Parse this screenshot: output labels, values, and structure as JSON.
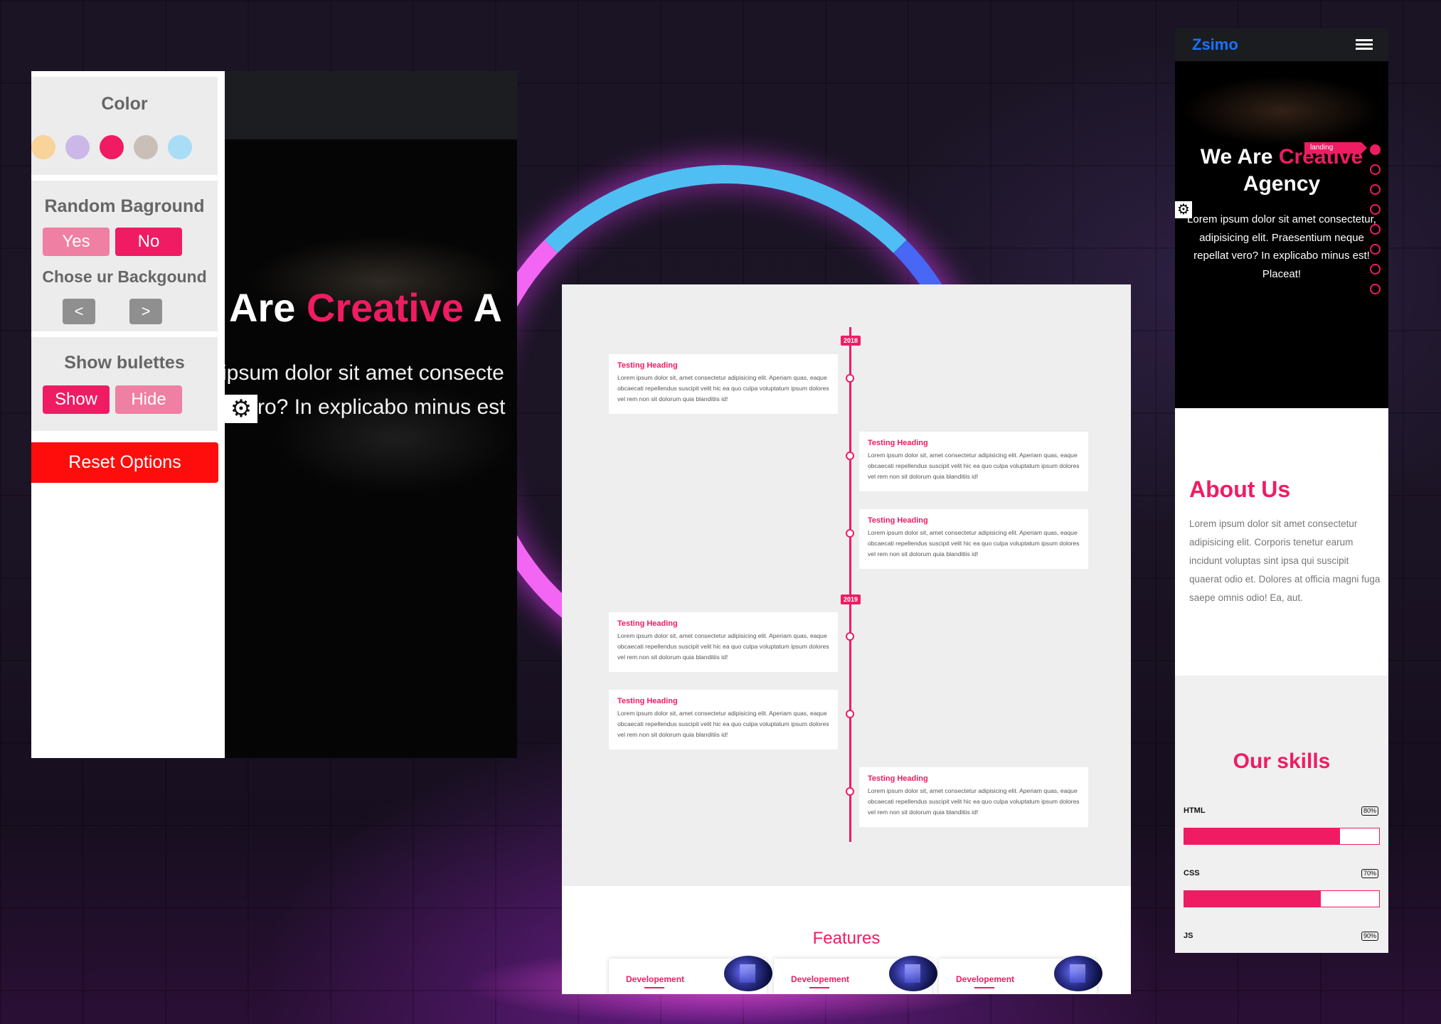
{
  "left_window": {
    "hero_title_white": "Are ",
    "hero_title_pink": "Creative",
    "hero_title_tail": " A",
    "hero_line1": "ipsum dolor sit amet consecte",
    "hero_line2": "ro? In explicabo minus est",
    "settings": {
      "color_title": "Color",
      "swatches": [
        "#f8d39a",
        "#cbb7e8",
        "#ef1c63",
        "#c9bfb7",
        "#a9dcf5"
      ],
      "random_bg_title": "Random Baground",
      "yes_label": "Yes",
      "no_label": "No",
      "choose_bg_title": "Chose ur Backgound",
      "prev_label": "<",
      "next_label": ">",
      "bullets_title": "Show bulettes",
      "show_label": "Show",
      "hide_label": "Hide",
      "reset_label": "Reset Options"
    }
  },
  "timeline": {
    "years": [
      "2018",
      "2019"
    ],
    "items": [
      {
        "heading": "Testing Heading",
        "text": "Lorem ipsum dolor sit, amet consectetur adipisicing elit. Aperiam quas, eaque obcaecati repellendus suscipit velit hic ea quo culpa voluptatum ipsum dolores vel rem non sit dolorum quia blanditiis id!"
      },
      {
        "heading": "Testing Heading",
        "text": "Lorem ipsum dolor sit, amet consectetur adipisicing elit. Aperiam quas, eaque obcaecati repellendus suscipit velit hic ea quo culpa voluptatum ipsum dolores vel rem non sit dolorum quia blanditiis id!"
      },
      {
        "heading": "Testing Heading",
        "text": "Lorem ipsum dolor sit, amet consectetur adipisicing elit. Aperiam quas, eaque obcaecati repellendus suscipit velit hic ea quo culpa voluptatum ipsum dolores vel rem non sit dolorum quia blanditiis id!"
      },
      {
        "heading": "Testing Heading",
        "text": "Lorem ipsum dolor sit, amet consectetur adipisicing elit. Aperiam quas, eaque obcaecati repellendus suscipit velit hic ea quo culpa voluptatum ipsum dolores vel rem non sit dolorum quia blanditiis id!"
      },
      {
        "heading": "Testing Heading",
        "text": "Lorem ipsum dolor sit, amet consectetur adipisicing elit. Aperiam quas, eaque obcaecati repellendus suscipit velit hic ea quo culpa voluptatum ipsum dolores vel rem non sit dolorum quia blanditiis id!"
      },
      {
        "heading": "Testing Heading",
        "text": "Lorem ipsum dolor sit, amet consectetur adipisicing elit. Aperiam quas, eaque obcaecati repellendus suscipit velit hic ea quo culpa voluptatum ipsum dolores vel rem non sit dolorum quia blanditiis id!"
      }
    ],
    "features_title": "Features",
    "feature_cards": [
      "Developement",
      "Developement",
      "Developement"
    ]
  },
  "mobile": {
    "logo": "Zsimo",
    "hero_title_white": "We Are ",
    "hero_title_pink": "Creative",
    "hero_title_line2": "Agency",
    "hero_text": "Lorem ipsum dolor sit amet consectetur, adipisicing elit. Praesentium neque repellat vero? In explicabo minus est! Placeat!",
    "tag_label": "landing",
    "about_title": "About Us",
    "about_text": "Lorem ipsum dolor sit amet consectetur adipisicing elit. Corporis tenetur earum incidunt voluptas sint ipsa qui suscipit quaerat odio et. Dolores at officia magni fuga saepe omnis odio! Ea, aut.",
    "skills_title": "Our skills",
    "skills": [
      {
        "name": "HTML",
        "percent_label": "80%",
        "percent": 80
      },
      {
        "name": "CSS",
        "percent_label": "70%",
        "percent": 70
      },
      {
        "name": "JS",
        "percent_label": "90%",
        "percent": 90
      }
    ]
  },
  "colors": {
    "accent": "#ef1c63",
    "reset": "#ff0d0d",
    "logo": "#1a73ff"
  }
}
